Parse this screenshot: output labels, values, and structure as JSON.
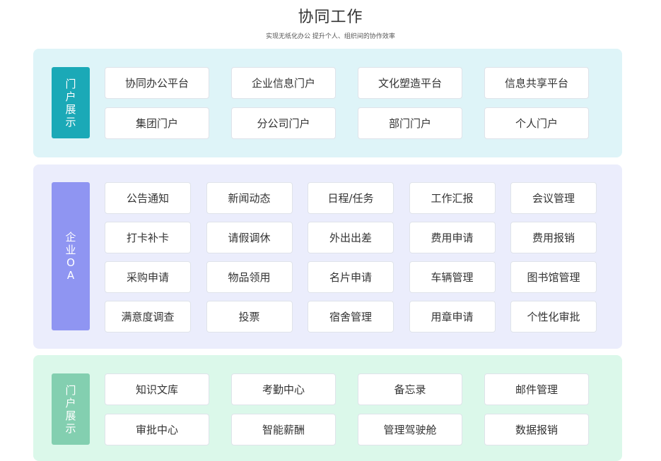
{
  "header": {
    "title": "协同工作",
    "subtitle": "实现无纸化办公 提升个人、组织间的协作效率"
  },
  "sections": [
    {
      "tag": "门户展示",
      "items": [
        "协同办公平台",
        "企业信息门户",
        "文化塑造平台",
        "信息共享平台",
        "集团门户",
        "分公司门户",
        "部门门户",
        "个人门户"
      ]
    },
    {
      "tag": "企业OA",
      "items": [
        "公告通知",
        "新闻动态",
        "日程/任务",
        "工作汇报",
        "会议管理",
        "打卡补卡",
        "请假调休",
        "外出出差",
        "费用申请",
        "费用报销",
        "采购申请",
        "物品领用",
        "名片申请",
        "车辆管理",
        "图书馆管理",
        "满意度调查",
        "投票",
        "宿舍管理",
        "用章申请",
        "个性化审批"
      ]
    },
    {
      "tag": "门户展示",
      "items": [
        "知识文库",
        "考勤中心",
        "备忘录",
        "邮件管理",
        "审批中心",
        "智能薪酬",
        "管理驾驶舱",
        "数据报销"
      ]
    }
  ],
  "colors": {
    "section1_bg": "#def4f8",
    "section1_tag": "#1ba9b7",
    "section2_bg": "#ebedfc",
    "section2_tag": "#8f95f2",
    "section3_bg": "#dbf8ea",
    "section3_tag": "#83cfb0"
  }
}
